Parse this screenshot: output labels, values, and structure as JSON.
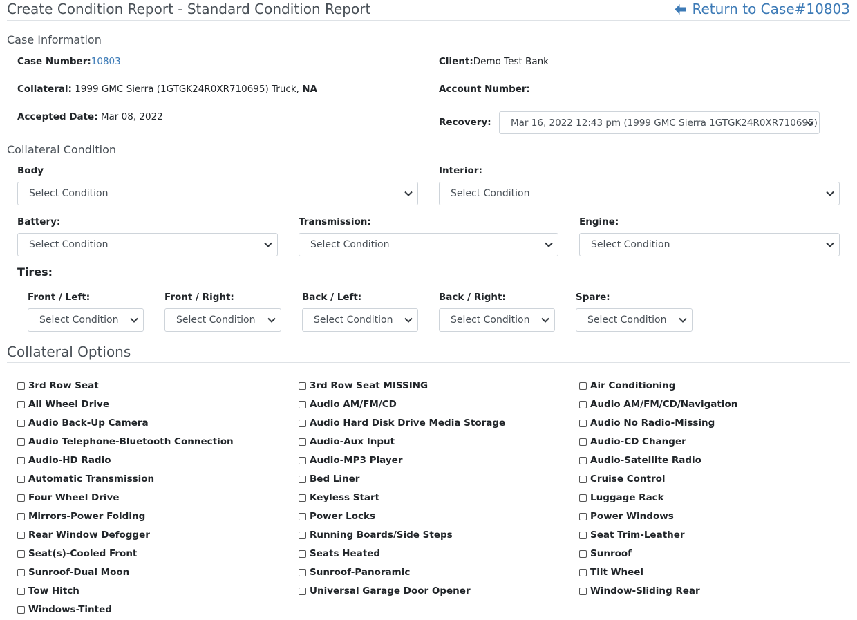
{
  "header": {
    "title": "Create Condition Report - Standard Condition Report",
    "return_link": "Return to Case#10803",
    "return_icon": "arrow-left-icon"
  },
  "case_info": {
    "title": "Case Information",
    "case_number_label": "Case Number:",
    "case_number_value": "10803",
    "client_label": "Client:",
    "client_value": "Demo Test Bank",
    "collateral_label": "Collateral:",
    "collateral_value": " 1999 GMC Sierra (1GTGK24R0XR710695) Truck, ",
    "collateral_suffix": "NA",
    "account_label": "Account Number:",
    "accepted_label": "Accepted Date:",
    "accepted_value": " Mar 08, 2022",
    "recovery_label": "Recovery:",
    "recovery_value": "Mar 16, 2022 12:43 pm (1999 GMC Sierra 1GTGK24R0XR710695)"
  },
  "condition": {
    "title": "Collateral Condition",
    "body_label": "Body",
    "interior_label": "Interior:",
    "battery_label": "Battery:",
    "transmission_label": "Transmission:",
    "engine_label": "Engine:",
    "tires_label": "Tires:",
    "front_left_label": "Front / Left:",
    "front_right_label": "Front / Right:",
    "back_left_label": "Back / Left:",
    "back_right_label": "Back / Right:",
    "spare_label": "Spare:",
    "select_placeholder": "Select Condition"
  },
  "options": {
    "title": "Collateral Options",
    "items": [
      "3rd Row Seat",
      "3rd Row Seat MISSING",
      "Air Conditioning",
      "All Wheel Drive",
      "Audio AM/FM/CD",
      "Audio AM/FM/CD/Navigation",
      "Audio Back-Up Camera",
      "Audio Hard Disk Drive Media Storage",
      "Audio No Radio-Missing",
      "Audio Telephone-Bluetooth Connection",
      "Audio-Aux Input",
      "Audio-CD Changer",
      "Audio-HD Radio",
      "Audio-MP3 Player",
      "Audio-Satellite Radio",
      "Automatic Transmission",
      "Bed Liner",
      "Cruise Control",
      "Four Wheel Drive",
      "Keyless Start",
      "Luggage Rack",
      "Mirrors-Power Folding",
      "Power Locks",
      "Power Windows",
      "Rear Window Defogger",
      "Running Boards/Side Steps",
      "Seat Trim-Leather",
      "Seat(s)-Cooled Front",
      "Seats Heated",
      "Sunroof",
      "Sunroof-Dual Moon",
      "Sunroof-Panoramic",
      "Tilt Wheel",
      "Tow Hitch",
      "Universal Garage Door Opener",
      "Window-Sliding Rear",
      "Windows-Tinted"
    ]
  }
}
